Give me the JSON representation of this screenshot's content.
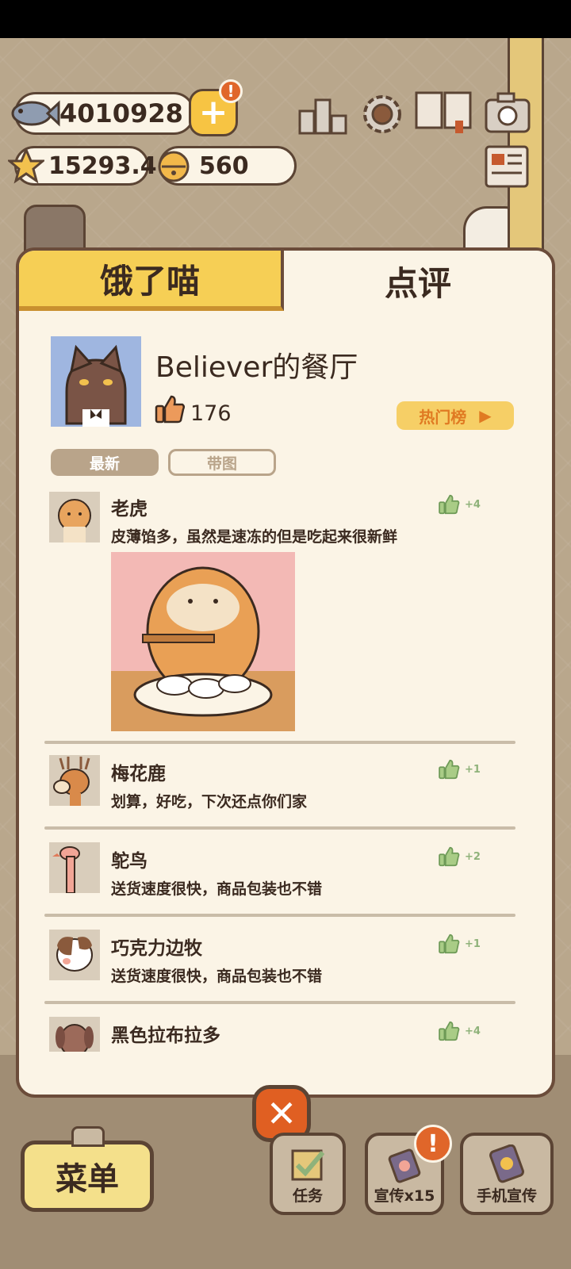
{
  "currency": {
    "fish": "4010928",
    "stars": "15293.4",
    "bells": "560"
  },
  "alert_badge": "!",
  "icons": {
    "fish": "fish-icon",
    "plus": "plus-icon",
    "star": "star-icon",
    "bell": "bell-icon",
    "ranking": "ranking-podium-icon",
    "settings": "gear-icon",
    "book": "recipe-book-icon",
    "camera": "camera-icon",
    "newspaper": "newspaper-icon"
  },
  "tabs": [
    {
      "label": "饿了喵",
      "active": false
    },
    {
      "label": "点评",
      "active": true
    }
  ],
  "restaurant": {
    "name": "Believer的餐厅",
    "likes": "176",
    "hot_list": "热门榜"
  },
  "filters": [
    "最新",
    "带图"
  ],
  "reviews": [
    {
      "name": "老虎",
      "text": "皮薄馅多，虽然是速冻的但是吃起来很新鲜",
      "likes": "+4",
      "has_image": true
    },
    {
      "name": "梅花鹿",
      "text": "划算，好吃，下次还点你们家",
      "likes": "+1"
    },
    {
      "name": "鸵鸟",
      "text": "送货速度很快，商品包装也不错",
      "likes": "+2"
    },
    {
      "name": "巧克力边牧",
      "text": "送货速度很快，商品包装也不错",
      "likes": "+1"
    },
    {
      "name": "黑色拉布拉多",
      "text": "",
      "likes": "+4"
    }
  ],
  "close_label": "✕",
  "bottom": {
    "menu": "菜单",
    "tasks": "任务",
    "promo": "宣传x15",
    "phone_promo": "手机宣传"
  },
  "colors": {
    "panel_bg": "#fbf4e6",
    "border": "#6b4c3a",
    "tab_active": "#f6cf55",
    "accent_orange": "#e05f22",
    "like_green": "#8fb27a"
  }
}
